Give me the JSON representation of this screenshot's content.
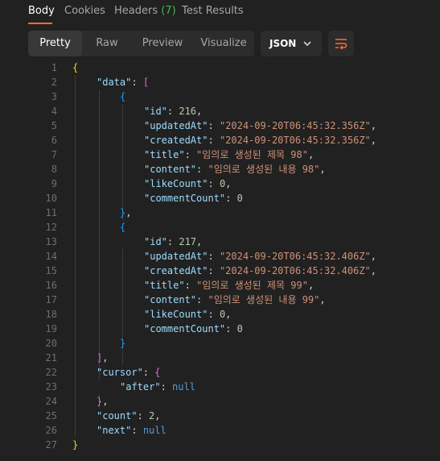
{
  "tabs": [
    {
      "label": "Body",
      "active": true
    },
    {
      "label": "Cookies"
    },
    {
      "label": "Headers",
      "count": "(7)"
    },
    {
      "label": "Test Results"
    }
  ],
  "view_modes": [
    "Pretty",
    "Raw",
    "Preview",
    "Visualize"
  ],
  "active_view": "Pretty",
  "format": "JSON",
  "lines": [
    [
      [
        "{",
        "b"
      ]
    ],
    [
      [
        "\"data\"",
        "k"
      ],
      [
        ": ",
        "p"
      ],
      [
        "[",
        "b2"
      ]
    ],
    [
      [
        "{",
        "b3"
      ]
    ],
    [
      [
        "\"id\"",
        "k"
      ],
      [
        ": ",
        "p"
      ],
      [
        "216",
        "n"
      ],
      [
        ",",
        "p"
      ]
    ],
    [
      [
        "\"updatedAt\"",
        "k"
      ],
      [
        ": ",
        "p"
      ],
      [
        "\"2024-09-20T06:45:32.356Z\"",
        "s"
      ],
      [
        ",",
        "p"
      ]
    ],
    [
      [
        "\"createdAt\"",
        "k"
      ],
      [
        ": ",
        "p"
      ],
      [
        "\"2024-09-20T06:45:32.356Z\"",
        "s"
      ],
      [
        ",",
        "p"
      ]
    ],
    [
      [
        "\"title\"",
        "k"
      ],
      [
        ": ",
        "p"
      ],
      [
        "\"임의로 생성된 제목 98\"",
        "s"
      ],
      [
        ",",
        "p"
      ]
    ],
    [
      [
        "\"content\"",
        "k"
      ],
      [
        ": ",
        "p"
      ],
      [
        "\"임의로 생성된 내용 98\"",
        "s"
      ],
      [
        ",",
        "p"
      ]
    ],
    [
      [
        "\"likeCount\"",
        "k"
      ],
      [
        ": ",
        "p"
      ],
      [
        "0",
        "n"
      ],
      [
        ",",
        "p"
      ]
    ],
    [
      [
        "\"commentCount\"",
        "k"
      ],
      [
        ": ",
        "p"
      ],
      [
        "0",
        "n"
      ]
    ],
    [
      [
        "}",
        "b3"
      ],
      [
        ",",
        "p"
      ]
    ],
    [
      [
        "{",
        "b3"
      ]
    ],
    [
      [
        "\"id\"",
        "k"
      ],
      [
        ": ",
        "p"
      ],
      [
        "217",
        "n"
      ],
      [
        ",",
        "p"
      ]
    ],
    [
      [
        "\"updatedAt\"",
        "k"
      ],
      [
        ": ",
        "p"
      ],
      [
        "\"2024-09-20T06:45:32.406Z\"",
        "s"
      ],
      [
        ",",
        "p"
      ]
    ],
    [
      [
        "\"createdAt\"",
        "k"
      ],
      [
        ": ",
        "p"
      ],
      [
        "\"2024-09-20T06:45:32.406Z\"",
        "s"
      ],
      [
        ",",
        "p"
      ]
    ],
    [
      [
        "\"title\"",
        "k"
      ],
      [
        ": ",
        "p"
      ],
      [
        "\"임의로 생성된 제목 99\"",
        "s"
      ],
      [
        ",",
        "p"
      ]
    ],
    [
      [
        "\"content\"",
        "k"
      ],
      [
        ": ",
        "p"
      ],
      [
        "\"임의로 생성된 내용 99\"",
        "s"
      ],
      [
        ",",
        "p"
      ]
    ],
    [
      [
        "\"likeCount\"",
        "k"
      ],
      [
        ": ",
        "p"
      ],
      [
        "0",
        "n"
      ],
      [
        ",",
        "p"
      ]
    ],
    [
      [
        "\"commentCount\"",
        "k"
      ],
      [
        ": ",
        "p"
      ],
      [
        "0",
        "n"
      ]
    ],
    [
      [
        "}",
        "b3"
      ]
    ],
    [
      [
        "]",
        "b2"
      ],
      [
        ",",
        "p"
      ]
    ],
    [
      [
        "\"cursor\"",
        "k"
      ],
      [
        ": ",
        "p"
      ],
      [
        "{",
        "b2"
      ]
    ],
    [
      [
        "\"after\"",
        "k"
      ],
      [
        ": ",
        "p"
      ],
      [
        "null",
        "nl"
      ]
    ],
    [
      [
        "}",
        "b2"
      ],
      [
        ",",
        "p"
      ]
    ],
    [
      [
        "\"count\"",
        "k"
      ],
      [
        ": ",
        "p"
      ],
      [
        "2",
        "n"
      ],
      [
        ",",
        "p"
      ]
    ],
    [
      [
        "\"next\"",
        "k"
      ],
      [
        ": ",
        "p"
      ],
      [
        "null",
        "nl"
      ]
    ],
    [
      [
        "}",
        "b"
      ]
    ]
  ]
}
